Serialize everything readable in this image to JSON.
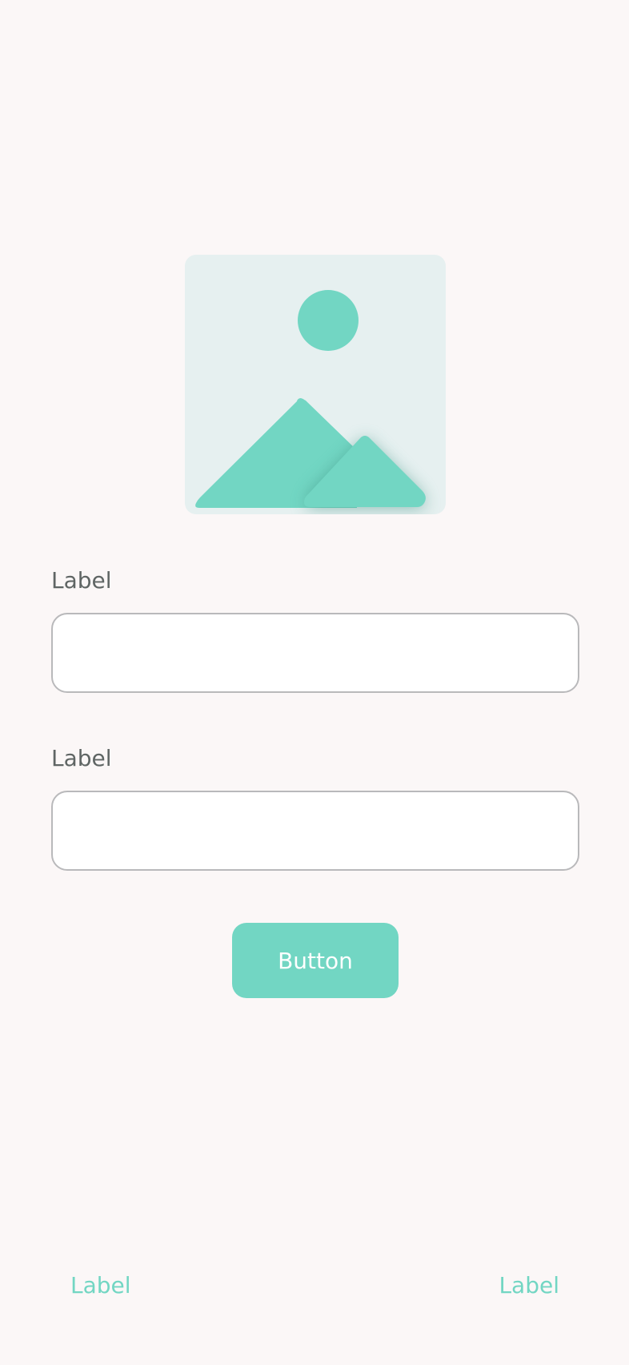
{
  "image_placeholder": {
    "icon": "image-placeholder-icon"
  },
  "form": {
    "field1": {
      "label": "Label",
      "value": "",
      "placeholder": ""
    },
    "field2": {
      "label": "Label",
      "value": "",
      "placeholder": ""
    },
    "button_label": "Button"
  },
  "footer": {
    "left_link": "Label",
    "right_link": "Label"
  },
  "colors": {
    "accent": "#72d6c3",
    "background": "#fbf7f7",
    "placeholder_bg": "#e6f0f0",
    "label_text": "#5f6564",
    "field_border": "#b9b9bb"
  }
}
